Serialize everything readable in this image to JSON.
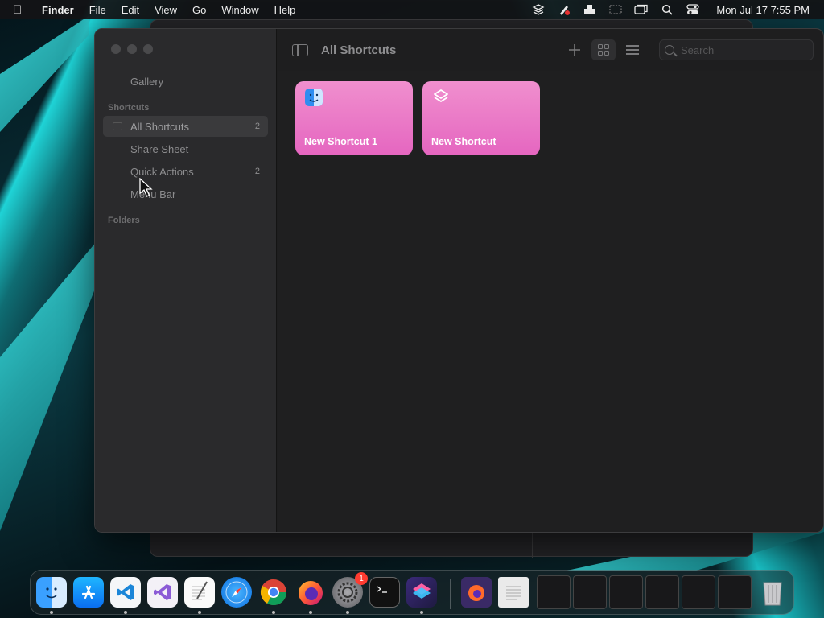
{
  "menubar": {
    "app_name": "Finder",
    "menus": [
      "File",
      "Edit",
      "View",
      "Go",
      "Window",
      "Help"
    ],
    "status_icons": [
      "shortcuts-icon",
      "scripts-icon",
      "user-icon",
      "screen-icon",
      "window-icon",
      "search-icon",
      "control-center-icon"
    ],
    "clock": "Mon Jul 17  7:55 PM"
  },
  "window": {
    "title": "All Shortcuts",
    "sidebar": {
      "gallery_label": "Gallery",
      "section_shortcuts": "Shortcuts",
      "items": [
        {
          "label": "All Shortcuts",
          "count": "2",
          "selected": true
        },
        {
          "label": "Share Sheet",
          "count": ""
        },
        {
          "label": "Quick Actions",
          "count": "2"
        },
        {
          "label": "Menu Bar",
          "count": ""
        }
      ],
      "section_folders": "Folders"
    },
    "toolbar": {
      "add_icon": "plus-icon",
      "grid_view_icon": "grid-icon",
      "list_view_icon": "list-icon",
      "search_placeholder": "Search",
      "search_value": ""
    },
    "shortcuts": [
      {
        "name": "New Shortcut 1",
        "icon": "finder-icon"
      },
      {
        "name": "New Shortcut",
        "icon": "shortcuts-layers-icon"
      }
    ]
  },
  "dock": {
    "apps": [
      "Finder",
      "App Store",
      "Visual Studio Code",
      "Visual Studio",
      "TextEdit",
      "Safari",
      "Google Chrome",
      "Firefox",
      "System Settings",
      "Terminal",
      "Shortcuts"
    ],
    "settings_badge": "1",
    "right_items": [
      "Firefox Document",
      "Text Document",
      "Window Thumbnail 1",
      "Window Thumbnail 2",
      "Window Thumbnail 3",
      "Window Thumbnail 4",
      "Window Thumbnail 5",
      "Window Thumbnail 6",
      "Trash"
    ]
  },
  "colors": {
    "card_gradient_top": "#f08fce",
    "card_gradient_bottom": "#e566c0",
    "sidebar_bg": "#2a2a2c",
    "content_bg": "#1f1f20",
    "wallpaper_accent": "#1fd3d6"
  }
}
